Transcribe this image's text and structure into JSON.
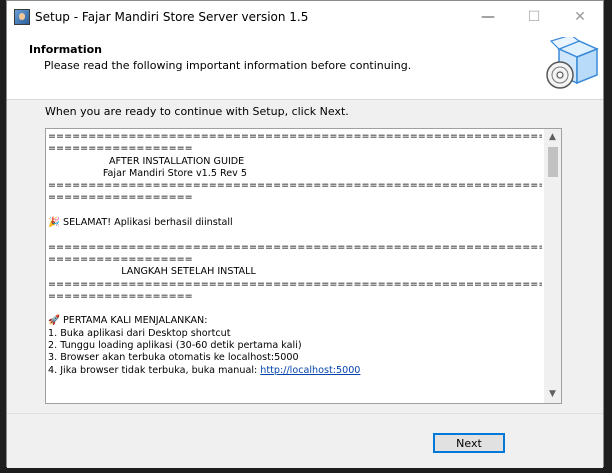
{
  "window": {
    "title": "Setup - Fajar Mandiri Store Server version 1.5",
    "controls": {
      "minimize": "—",
      "maximize": "☐",
      "close": "✕"
    }
  },
  "header": {
    "title": "Information",
    "subtitle": "Please read the following important information before continuing."
  },
  "instruction": "When you are ready to continue with Setup, click Next.",
  "memo": {
    "lines": [
      "=========================================================================",
      "==================",
      "                    AFTER INSTALLATION GUIDE",
      "                  Fajar Mandiri Store v1.5 Rev 5",
      "=========================================================================",
      "==================",
      "",
      "🎉 SELAMAT! Aplikasi berhasil diinstall",
      "",
      "=========================================================================",
      "==================",
      "                        LANGKAH SETELAH INSTALL",
      "=========================================================================",
      "==================",
      "",
      "🚀 PERTAMA KALI MENJALANKAN:",
      "1. Buka aplikasi dari Desktop shortcut",
      "2. Tunggu loading aplikasi (30-60 detik pertama kali)",
      "3. Browser akan terbuka otomatis ke localhost:5000",
      "4. Jika browser tidak terbuka, buka manual: "
    ],
    "link": "http://localhost:5000"
  },
  "footer": {
    "next_label": "Next"
  }
}
